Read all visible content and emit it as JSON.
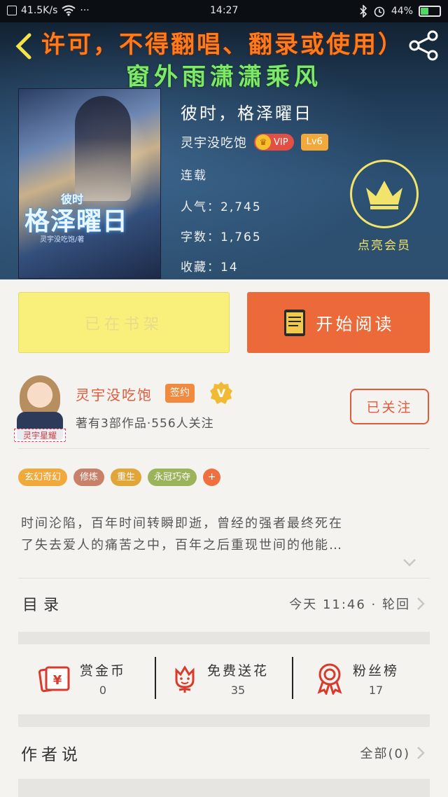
{
  "status_bar": {
    "net_speed": "41.5K/s",
    "dots": "···",
    "time": "14:27",
    "battery_percent": "44%",
    "battery_level": 0.44
  },
  "watermark": {
    "line1": "许可，不得翻唱、翻录或使用）",
    "line2": "窗外雨潇潇乘风"
  },
  "cover": {
    "title_small": "彼时",
    "title_large": "格泽曜日",
    "author_credit": "灵宇没吃饱/著"
  },
  "book": {
    "title": "彼时，格泽曜日",
    "author": "灵宇没吃饱",
    "vip_label": "VIP",
    "level": "Lv6",
    "status": "连载",
    "popularity": "人气：2,745",
    "word_count": "字数：1,765",
    "favorites": "收藏：14",
    "member_label": "点亮会员"
  },
  "actions": {
    "shelf_label": "已在书架",
    "read_label": "开始阅读"
  },
  "author_card": {
    "avatar_caption": "灵宇星耀",
    "name": "灵宇没吃饱",
    "signed_badge": "签约",
    "stats": "著有3部作品·556人关注",
    "follow_label": "已关注"
  },
  "tags": [
    {
      "label": "玄幻奇幻",
      "color": "#f0a93a"
    },
    {
      "label": "修炼",
      "color": "#c98068"
    },
    {
      "label": "重生",
      "color": "#e0a63a"
    },
    {
      "label": "永冠巧夺",
      "color": "#9bb35a"
    }
  ],
  "tag_add": "+",
  "description": {
    "line1": "时间沦陷，百年时间转瞬即逝，曾经的强者最终死在",
    "line2": "了失去爱人的痛苦之中，百年之后重现世间的他能…"
  },
  "toc": {
    "label": "目录",
    "latest": "今天 11:46 · 轮回"
  },
  "rewards": [
    {
      "title": "赏金币",
      "value": "0",
      "icon": "red-packet-icon"
    },
    {
      "title": "免费送花",
      "value": "35",
      "icon": "flower-icon"
    },
    {
      "title": "粉丝榜",
      "value": "17",
      "icon": "rank-badge-icon"
    }
  ],
  "author_says": {
    "label": "作者说",
    "count": "全部(0)"
  },
  "colors": {
    "accent_orange": "#ec6a3a",
    "shelf_yellow": "#f8f07a",
    "author_red": "#e2593a",
    "member_gold": "#f2e36a"
  }
}
